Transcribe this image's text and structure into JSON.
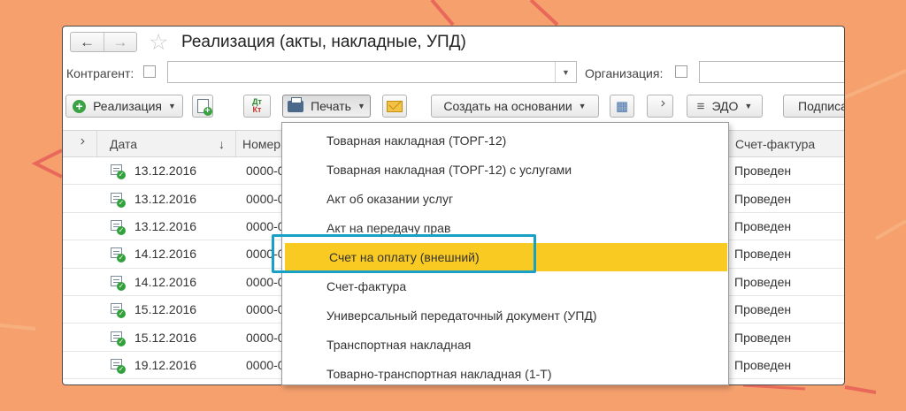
{
  "window": {
    "title": "Реализация (акты, накладные, УПД)"
  },
  "filters": {
    "counterparty_label": "Контрагент:",
    "counterparty_value": "",
    "organization_label": "Организация:",
    "organization_value": ""
  },
  "toolbar": {
    "sale_label": "Реализация",
    "dtkt_top": "Дт",
    "dtkt_bottom": "Кт",
    "print_label": "Печать",
    "create_based_label": "Создать на основании",
    "edo_label": "ЭДО",
    "sign_label": "Подписа"
  },
  "table": {
    "columns": {
      "date": "Дата",
      "sort_arrow": "↓",
      "number": "Номер",
      "invoice": "Счет-фактура"
    },
    "rows": [
      {
        "date": "13.12.2016",
        "number": "0000-0",
        "invoice": "Проведен"
      },
      {
        "date": "13.12.2016",
        "number": "0000-0",
        "invoice": "Проведен"
      },
      {
        "date": "13.12.2016",
        "number": "0000-0",
        "invoice": "Проведен"
      },
      {
        "date": "14.12.2016",
        "number": "0000-0",
        "invoice": "Проведен"
      },
      {
        "date": "14.12.2016",
        "number": "0000-0",
        "invoice": "Проведен"
      },
      {
        "date": "15.12.2016",
        "number": "0000-0",
        "invoice": "Проведен"
      },
      {
        "date": "15.12.2016",
        "number": "0000-0",
        "invoice": "Проведен"
      },
      {
        "date": "19.12.2016",
        "number": "0000-0",
        "invoice": "Проведен"
      }
    ]
  },
  "print_menu": {
    "items": [
      "Товарная накладная (ТОРГ-12)",
      "Товарная накладная (ТОРГ-12) с услугами",
      "Акт об оказании услуг",
      "Акт на передачу прав",
      "Счет на оплату (внешний)",
      "Счет-фактура",
      "Универсальный передаточный документ (УПД)",
      "Транспортная накладная",
      "Товарно-транспортная накладная (1-Т)"
    ],
    "active_index": 4,
    "highlight_color": "#f9ca22",
    "callout_color": "#18a0c6"
  },
  "colors": {
    "background": "#f6a06e",
    "accent_lines": "#e8695a"
  }
}
